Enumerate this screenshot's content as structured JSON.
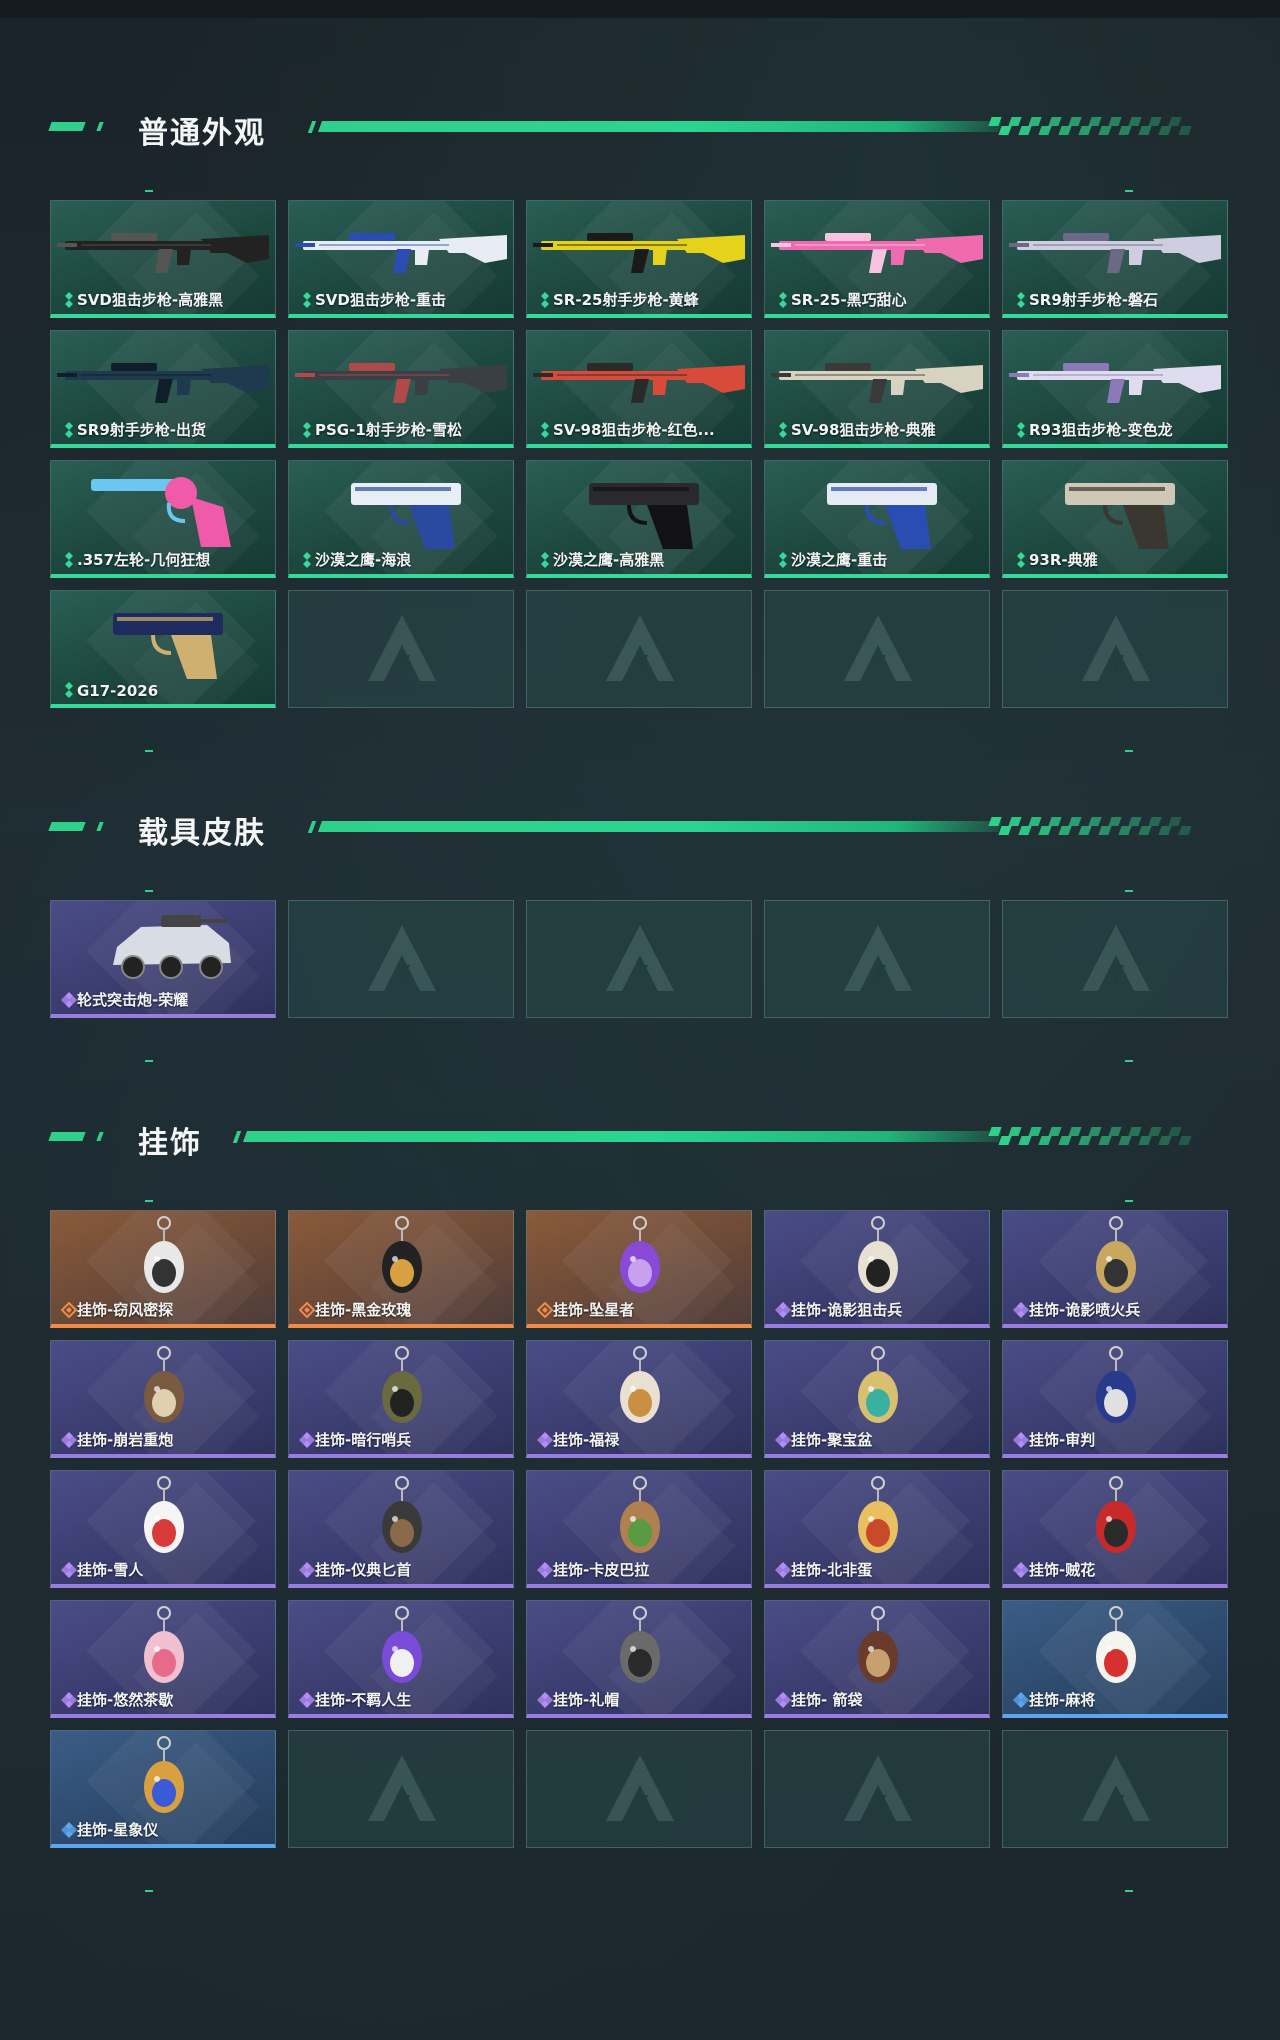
{
  "sections": [
    {
      "title": "普通外观",
      "items": [
        {
          "label": "SVD狙击步枪-高雅黑",
          "rarity": "green",
          "icon": "rifle-icon",
          "colors": [
            "#222",
            "#555"
          ]
        },
        {
          "label": "SVD狙击步枪-重击",
          "rarity": "green",
          "icon": "rifle-icon",
          "colors": [
            "#e8ecf5",
            "#2a4db3"
          ]
        },
        {
          "label": "SR-25射手步枪-黄蜂",
          "rarity": "green",
          "icon": "rifle-icon",
          "colors": [
            "#e6d21a",
            "#1a1a1a"
          ]
        },
        {
          "label": "SR-25-黑巧甜心",
          "rarity": "green",
          "icon": "rifle-icon",
          "colors": [
            "#f06ab0",
            "#f7c3e0"
          ]
        },
        {
          "label": "SR9射手步枪-磐石",
          "rarity": "green",
          "icon": "rifle-icon",
          "colors": [
            "#cfcde0",
            "#6b6a86"
          ]
        },
        {
          "label": "SR9射手步枪-出货",
          "rarity": "green",
          "icon": "rifle-icon",
          "colors": [
            "#1f3a4e",
            "#0f1e2a"
          ]
        },
        {
          "label": "PSG-1射手步枪-雪松",
          "rarity": "green",
          "icon": "rifle-icon",
          "colors": [
            "#3a3f45",
            "#b04a4a"
          ]
        },
        {
          "label": "SV-98狙击步枪-红色...",
          "rarity": "green",
          "icon": "rifle-icon",
          "colors": [
            "#d84a3a",
            "#2a2a2a"
          ]
        },
        {
          "label": "SV-98狙击步枪-典雅",
          "rarity": "green",
          "icon": "rifle-icon",
          "colors": [
            "#d8d2c0",
            "#3a3a3a"
          ]
        },
        {
          "label": "R93狙击步枪-变色龙",
          "rarity": "green",
          "icon": "rifle-icon",
          "colors": [
            "#e0dcf0",
            "#8a7ab8"
          ]
        },
        {
          "label": ".357左轮-几何狂想",
          "rarity": "green",
          "icon": "revolver-icon",
          "colors": [
            "#f05aa8",
            "#6ac8f0"
          ]
        },
        {
          "label": "沙漠之鹰-海浪",
          "rarity": "green",
          "icon": "pistol-icon",
          "colors": [
            "#e8eef5",
            "#2a4aa0"
          ]
        },
        {
          "label": "沙漠之鹰-高雅黑",
          "rarity": "green",
          "icon": "pistol-icon",
          "colors": [
            "#2a2a2e",
            "#121214"
          ]
        },
        {
          "label": "沙漠之鹰-重击",
          "rarity": "green",
          "icon": "pistol-icon",
          "colors": [
            "#e6eaf5",
            "#2a4db3"
          ]
        },
        {
          "label": "93R-典雅",
          "rarity": "green",
          "icon": "pistol-icon",
          "colors": [
            "#cfc8b6",
            "#3a3630"
          ]
        },
        {
          "label": "G17-2026",
          "rarity": "green",
          "icon": "pistol-icon",
          "colors": [
            "#1f2a5e",
            "#d0b070"
          ]
        }
      ]
    },
    {
      "title": "载具皮肤",
      "items": [
        {
          "label": "轮式突击炮-荣耀",
          "rarity": "purple",
          "icon": "vehicle-icon",
          "colors": [
            "#d8dde5",
            "#444"
          ]
        }
      ]
    },
    {
      "title": "挂饰",
      "items": [
        {
          "label": "挂饰-窃风密探",
          "rarity": "orange",
          "icon": "charm-icon",
          "colors": [
            "#e8e8e8",
            "#333"
          ]
        },
        {
          "label": "挂饰-黑金玫瑰",
          "rarity": "orange",
          "icon": "charm-icon",
          "colors": [
            "#222",
            "#d8a040"
          ]
        },
        {
          "label": "挂饰-坠星者",
          "rarity": "orange",
          "icon": "charm-icon",
          "colors": [
            "#8a4ad8",
            "#c8a0f0"
          ]
        },
        {
          "label": "挂饰-诡影狙击兵",
          "rarity": "purple",
          "icon": "charm-icon",
          "colors": [
            "#e8e0d0",
            "#222"
          ]
        },
        {
          "label": "挂饰-诡影喷火兵",
          "rarity": "purple",
          "icon": "charm-icon",
          "colors": [
            "#c8a860",
            "#333"
          ]
        },
        {
          "label": "挂饰-崩岩重炮",
          "rarity": "purple",
          "icon": "charm-icon",
          "colors": [
            "#7a5a40",
            "#e0d0b0"
          ]
        },
        {
          "label": "挂饰-暗行哨兵",
          "rarity": "purple",
          "icon": "charm-icon",
          "colors": [
            "#6a6a40",
            "#222"
          ]
        },
        {
          "label": "挂饰-福禄",
          "rarity": "purple",
          "icon": "charm-icon",
          "colors": [
            "#e8e0d0",
            "#c89040"
          ]
        },
        {
          "label": "挂饰-聚宝盆",
          "rarity": "purple",
          "icon": "charm-icon",
          "colors": [
            "#d8c070",
            "#3ab0a0"
          ]
        },
        {
          "label": "挂饰-审判",
          "rarity": "purple",
          "icon": "charm-icon",
          "colors": [
            "#2a3a8a",
            "#e0e0e0"
          ]
        },
        {
          "label": "挂饰-雪人",
          "rarity": "purple",
          "icon": "charm-icon",
          "colors": [
            "#f5f5f5",
            "#d83a3a"
          ]
        },
        {
          "label": "挂饰-仪典匕首",
          "rarity": "purple",
          "icon": "charm-icon",
          "colors": [
            "#3a3a3a",
            "#8a6a4a"
          ]
        },
        {
          "label": "挂饰-卡皮巴拉",
          "rarity": "purple",
          "icon": "charm-icon",
          "colors": [
            "#b08050",
            "#5a9a40"
          ]
        },
        {
          "label": "挂饰-北非蛋",
          "rarity": "purple",
          "icon": "charm-icon",
          "colors": [
            "#e8c060",
            "#c84a2a"
          ]
        },
        {
          "label": "挂饰-贼花",
          "rarity": "purple",
          "icon": "charm-icon",
          "colors": [
            "#c82a2a",
            "#2a2a2a"
          ]
        },
        {
          "label": "挂饰-悠然茶歇",
          "rarity": "purple",
          "icon": "charm-icon",
          "colors": [
            "#f0c0d0",
            "#e86a8a"
          ]
        },
        {
          "label": "挂饰-不羁人生",
          "rarity": "purple",
          "icon": "charm-icon",
          "colors": [
            "#7a4ad8",
            "#f0f0f0"
          ]
        },
        {
          "label": "挂饰-礼帽",
          "rarity": "purple",
          "icon": "charm-icon",
          "colors": [
            "#6a6a6a",
            "#2a2a2a"
          ]
        },
        {
          "label": "挂饰- 箭袋",
          "rarity": "purple",
          "icon": "charm-icon",
          "colors": [
            "#6a3a2a",
            "#c8a070"
          ]
        },
        {
          "label": "挂饰-麻将",
          "rarity": "blue",
          "icon": "charm-icon",
          "colors": [
            "#f5f5f0",
            "#d83030"
          ]
        },
        {
          "label": "挂饰-星象仪",
          "rarity": "blue",
          "icon": "charm-icon",
          "colors": [
            "#d8a040",
            "#3a5ad8"
          ]
        }
      ]
    }
  ]
}
